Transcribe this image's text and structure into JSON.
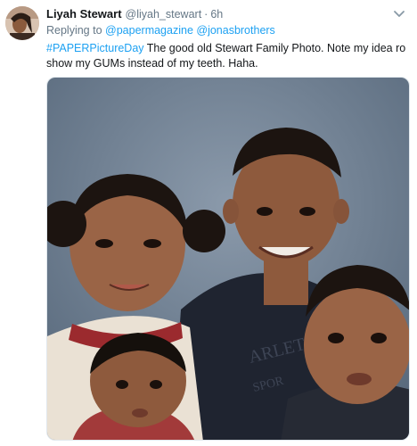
{
  "tweet": {
    "display_name": "Liyah Stewart",
    "handle": "@liyah_stewart",
    "separator": "·",
    "time": "6h",
    "reply_prefix": "Replying to",
    "reply_mentions": [
      "@papermagazine",
      "@jonasbrothers"
    ],
    "hashtag": "#PAPERPictureDay",
    "body": " The good old Stewart Family Photo. Note my idea ro show my GUMs instead of my teeth. Haha.",
    "shirt_print": [
      "ARLET",
      "SPOR"
    ]
  },
  "icons": {
    "avatar": "profile-photo",
    "caret": "chevron-down-icon",
    "photo": "family-photo"
  },
  "colors": {
    "link": "#1da1f2",
    "secondary_text": "#657786",
    "primary_text": "#14171a",
    "photo_backdrop": "#6f8194"
  }
}
